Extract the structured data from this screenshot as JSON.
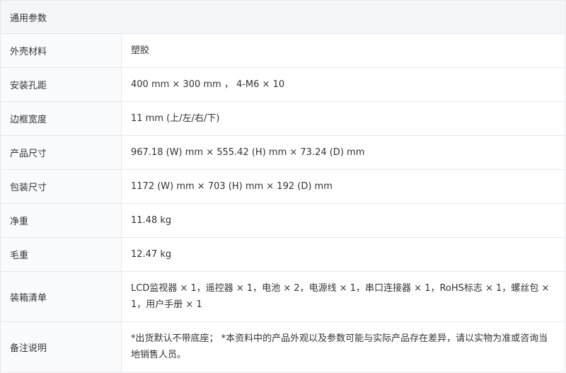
{
  "section": {
    "title": "通用参数"
  },
  "rows": [
    {
      "label": "外壳材料",
      "value": "塑胶"
    },
    {
      "label": "安装孔距",
      "value": "400 mm × 300 mm ， 4-M6 × 10"
    },
    {
      "label": "边框宽度",
      "value": "11 mm (上/左/右/下)"
    },
    {
      "label": "产品尺寸",
      "value": "967.18 (W) mm × 555.42 (H) mm × 73.24 (D) mm"
    },
    {
      "label": "包装尺寸",
      "value": "1172 (W) mm × 703 (H) mm × 192 (D) mm"
    },
    {
      "label": "净重",
      "value": "11.48 kg"
    },
    {
      "label": "毛重",
      "value": "12.47 kg"
    },
    {
      "label": "装箱清单",
      "value": "LCD监视器 × 1，遥控器 × 1，电池 × 2，电源线 × 1，串口连接器 × 1，RoHS标志 × 1，螺丝包 × 1，用户手册 × 1"
    },
    {
      "label": "备注说明",
      "value": "*出货默认不带底座； *本资料中的产品外观以及参数可能与实际产品存在差异，请以实物为准或咨询当地销售人员。"
    }
  ]
}
